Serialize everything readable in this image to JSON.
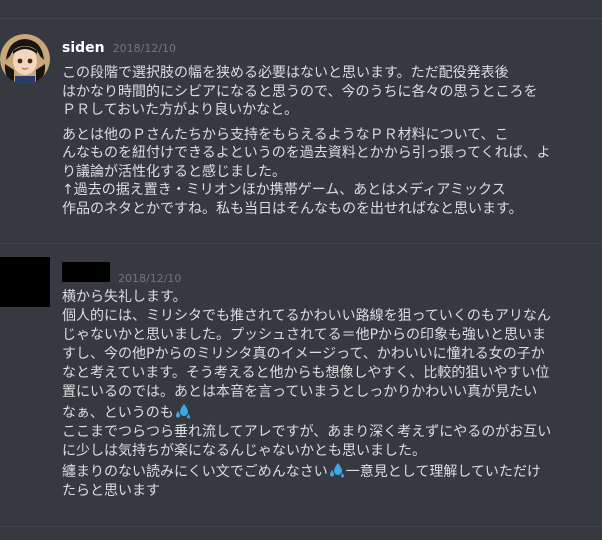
{
  "messages": [
    {
      "username": "siden",
      "timestamp": "2018/12/10",
      "paragraphs": [
        [
          "この段階で選択肢の幅を狭める必要はないと思います。ただ配役発表後",
          "はかなり時間的にシビアになると思うので、今のうちに各々の思うところを",
          "ＰＲしておいた方がより良いかなと。"
        ],
        [
          "あとは他のＰさんたちから支持をもらえるようなＰＲ材料について、こ",
          "んなものを紐付けできるよというのを過去資料とかから引っ張ってくれば、よ",
          "り議論が活性化すると感じました。",
          "↑過去の据え置き・ミリオンほか携帯ゲーム、あとはメディアミックス",
          "作品のネタとかですね。私も当日はそんなものを出せればなと思います。"
        ]
      ]
    },
    {
      "username": "",
      "timestamp": "2018/12/10",
      "lines": [
        "横から失礼します。",
        "個人的には、ミリシタでも推されてるかわいい路線を狙っていくのもアリなん",
        "じゃないかと思いました。プッシュされてる＝他Pからの印象も強いと思いま",
        "すし、今の他Pからのミリシタ真のイメージって、かわいいに憧れる女の子か",
        "なと考えています。そう考えると他からも想像しやすく、比較的狙いやすい位",
        "置にいるのでは。あとは本音を言っていまうとしっかりかわいい真が見たい",
        "なぁ、というのも",
        "ここまでつらつら垂れ流してアレですが、あまり深く考えずにやるのがお互い",
        "に少しは気持ちが楽になるんじゃないかとも思いました。",
        "纏まりのない読みにくい文でごめんなさい",
        "一意見として理解していただけ",
        "たらと思います"
      ],
      "emoji_name": "sweat-drops-icon"
    }
  ],
  "colors": {
    "background": "#36393f",
    "text": "#dcddde",
    "username": "#ffffff",
    "timestamp": "#72767d",
    "emoji": "#3ea6e8"
  }
}
